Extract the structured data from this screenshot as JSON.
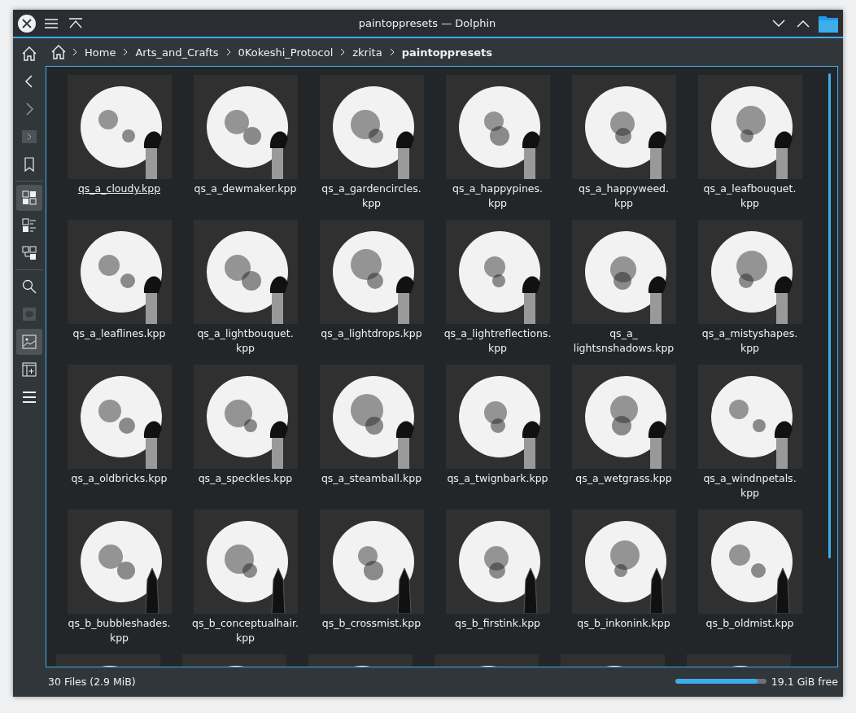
{
  "window": {
    "title": "paintoppresets — Dolphin"
  },
  "sidebar": {
    "items": [
      {
        "kind": "back",
        "selected": false,
        "disabled": false
      },
      {
        "kind": "forward",
        "selected": false,
        "disabled": true
      },
      {
        "kind": "terminal",
        "selected": false,
        "disabled": false
      },
      {
        "kind": "bookmark",
        "selected": false,
        "disabled": false
      },
      {
        "kind": "separator"
      },
      {
        "kind": "icons",
        "selected": true,
        "disabled": false
      },
      {
        "kind": "details",
        "selected": false,
        "disabled": false
      },
      {
        "kind": "tree",
        "selected": false,
        "disabled": false
      },
      {
        "kind": "separator"
      },
      {
        "kind": "search",
        "selected": false,
        "disabled": false
      },
      {
        "kind": "hidden",
        "selected": false,
        "disabled": true
      },
      {
        "kind": "preview",
        "selected": true,
        "disabled": false
      },
      {
        "kind": "panel",
        "selected": false,
        "disabled": false
      },
      {
        "kind": "menu",
        "selected": false,
        "disabled": false
      }
    ]
  },
  "breadcrumb": [
    "Home",
    "Arts_and_Crafts",
    "0Kokeshi_Protocol",
    "zkrita",
    "paintoppresets"
  ],
  "files": [
    {
      "name": "qs_a_cloudy.kpp",
      "focused": true,
      "kind": "brush"
    },
    {
      "name": "qs_a_dewmaker.kpp",
      "focused": false,
      "kind": "brush"
    },
    {
      "name": "qs_a_gardencircles.\nkpp",
      "focused": false,
      "kind": "brush"
    },
    {
      "name": "qs_a_happypines.\nkpp",
      "focused": false,
      "kind": "brush"
    },
    {
      "name": "qs_a_happyweed.\nkpp",
      "focused": false,
      "kind": "brush"
    },
    {
      "name": "qs_a_leafbouquet.\nkpp",
      "focused": false,
      "kind": "brush"
    },
    {
      "name": "qs_a_leaflines.kpp",
      "focused": false,
      "kind": "brush"
    },
    {
      "name": "qs_a_lightbouquet.\nkpp",
      "focused": false,
      "kind": "brush"
    },
    {
      "name": "qs_a_lightdrops.kpp",
      "focused": false,
      "kind": "brush"
    },
    {
      "name": "qs_a_lightreflections.\nkpp",
      "focused": false,
      "kind": "brush"
    },
    {
      "name": "qs_a_\nlightsnshadows.kpp",
      "focused": false,
      "kind": "brush"
    },
    {
      "name": "qs_a_mistyshapes.\nkpp",
      "focused": false,
      "kind": "brush"
    },
    {
      "name": "qs_a_oldbricks.kpp",
      "focused": false,
      "kind": "brush"
    },
    {
      "name": "qs_a_speckles.kpp",
      "focused": false,
      "kind": "brush"
    },
    {
      "name": "qs_a_steamball.kpp",
      "focused": false,
      "kind": "brush"
    },
    {
      "name": "qs_a_twignbark.kpp",
      "focused": false,
      "kind": "brush"
    },
    {
      "name": "qs_a_wetgrass.kpp",
      "focused": false,
      "kind": "brush"
    },
    {
      "name": "qs_a_windnpetals.\nkpp",
      "focused": false,
      "kind": "brush"
    },
    {
      "name": "qs_b_bubbleshades.\nkpp",
      "focused": false,
      "kind": "pen"
    },
    {
      "name": "qs_b_conceptualhair.\nkpp",
      "focused": false,
      "kind": "pen"
    },
    {
      "name": "qs_b_crossmist.kpp",
      "focused": false,
      "kind": "pen"
    },
    {
      "name": "qs_b_firstink.kpp",
      "focused": false,
      "kind": "pen"
    },
    {
      "name": "qs_b_inkonink.kpp",
      "focused": false,
      "kind": "pen"
    },
    {
      "name": "qs_b_oldmist.kpp",
      "focused": false,
      "kind": "pen"
    },
    {
      "cut_off": true
    },
    {
      "cut_off": true
    },
    {
      "cut_off": true
    },
    {
      "cut_off": true
    },
    {
      "cut_off": true
    },
    {
      "cut_off": true
    }
  ],
  "status_bar": {
    "summary": "30 Files (2.9 MiB)",
    "disk": {
      "level": 0.9,
      "free": "19.1 GiB free"
    }
  }
}
